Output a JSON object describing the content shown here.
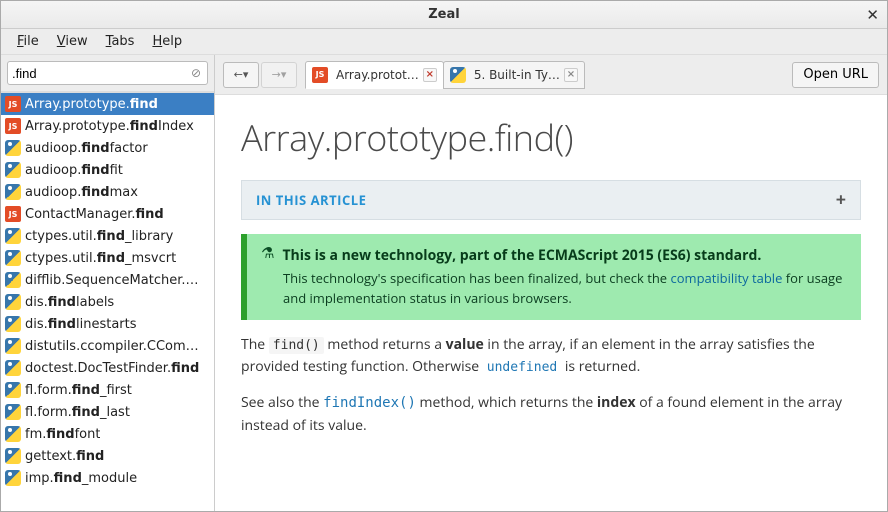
{
  "window": {
    "title": "Zeal"
  },
  "menubar": [
    {
      "label": "File",
      "accel": "F"
    },
    {
      "label": "View",
      "accel": "V"
    },
    {
      "label": "Tabs",
      "accel": "T"
    },
    {
      "label": "Help",
      "accel": "H"
    }
  ],
  "search": {
    "value": ".find"
  },
  "results": [
    {
      "icon": "js",
      "pre": "Array.prototype.",
      "match": "find",
      "post": "",
      "selected": true
    },
    {
      "icon": "js",
      "pre": "Array.prototype.",
      "match": "find",
      "post": "Index"
    },
    {
      "icon": "py",
      "pre": "audioop.",
      "match": "find",
      "post": "factor"
    },
    {
      "icon": "py",
      "pre": "audioop.",
      "match": "find",
      "post": "fit"
    },
    {
      "icon": "py",
      "pre": "audioop.",
      "match": "find",
      "post": "max"
    },
    {
      "icon": "js",
      "pre": "ContactManager.",
      "match": "find",
      "post": ""
    },
    {
      "icon": "py",
      "pre": "ctypes.util.",
      "match": "find",
      "post": "_library"
    },
    {
      "icon": "py",
      "pre": "ctypes.util.",
      "match": "find",
      "post": "_msvcrt"
    },
    {
      "icon": "py",
      "pre": "difflib.SequenceMatcher.",
      "match": "",
      "post": "…"
    },
    {
      "icon": "py",
      "pre": "dis.",
      "match": "find",
      "post": "labels"
    },
    {
      "icon": "py",
      "pre": "dis.",
      "match": "find",
      "post": "linestarts"
    },
    {
      "icon": "py",
      "pre": "distutils.ccompiler.CCom",
      "match": "",
      "post": "…"
    },
    {
      "icon": "py",
      "pre": "doctest.DocTestFinder.",
      "match": "find",
      "post": ""
    },
    {
      "icon": "py",
      "pre": "fl.form.",
      "match": "find",
      "post": "_first"
    },
    {
      "icon": "py",
      "pre": "fl.form.",
      "match": "find",
      "post": "_last"
    },
    {
      "icon": "py",
      "pre": "fm.",
      "match": "find",
      "post": "font"
    },
    {
      "icon": "py",
      "pre": "gettext.",
      "match": "find",
      "post": ""
    },
    {
      "icon": "py",
      "pre": "imp.",
      "match": "find",
      "post": "_module"
    }
  ],
  "tabs": [
    {
      "icon": "js",
      "label": "Array.protot…",
      "active": true,
      "close_color": "red"
    },
    {
      "icon": "py",
      "label": "5. Built-in Ty…",
      "active": false,
      "close_color": "gray"
    }
  ],
  "openurl_label": "Open URL",
  "article": {
    "heading": "Array.prototype.find()",
    "in_this_article": "IN THIS ARTICLE",
    "notice_title": "This is a new technology, part of the ECMAScript 2015 (ES6) standard.",
    "notice_body_1": "This technology's specification has been finalized, but check the ",
    "notice_link": "compatibility table",
    "notice_body_2": " for usage and implementation status in various browsers.",
    "p1_a": "The ",
    "p1_code": "find()",
    "p1_b": " method returns a ",
    "p1_bold": "value",
    "p1_c": " in the array, if an element in the array satisfies the provided testing function. Otherwise ",
    "p1_undef": "undefined",
    "p1_d": " is returned.",
    "p2_a": "See also the ",
    "p2_link": "findIndex()",
    "p2_b": " method, which returns the ",
    "p2_bold": "index",
    "p2_c": " of a found element in the array instead of its value."
  }
}
